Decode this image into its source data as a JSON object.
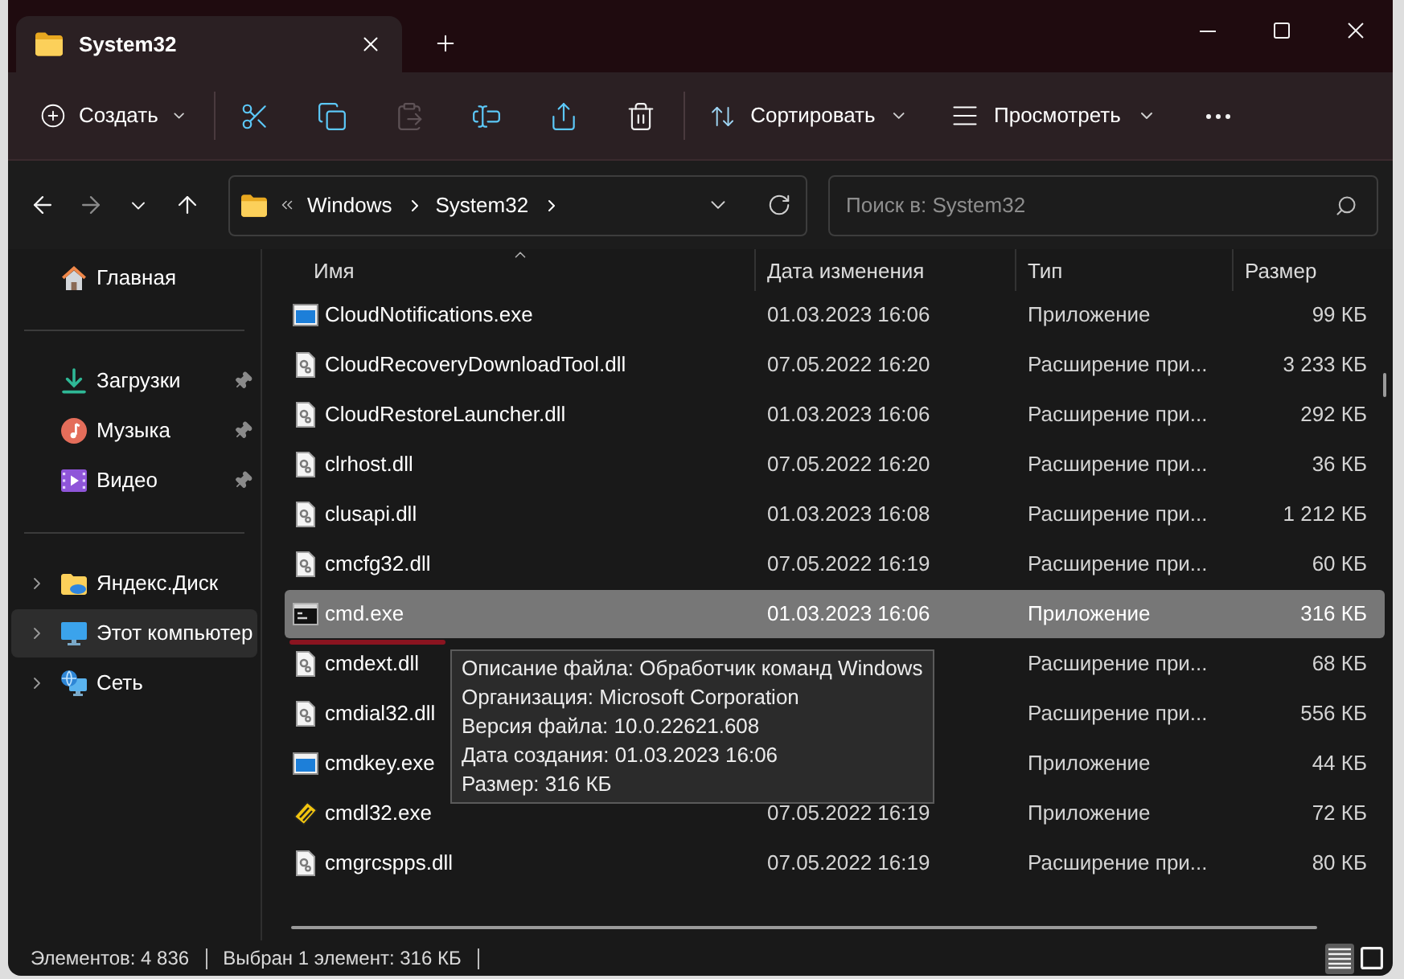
{
  "window": {
    "tab": {
      "title": "System32",
      "selected": true
    }
  },
  "toolbar": {
    "create": "Создать",
    "actions": [
      {
        "kind": "cut",
        "disabled": false
      },
      {
        "kind": "copy",
        "disabled": false
      },
      {
        "kind": "paste",
        "disabled": true
      },
      {
        "kind": "rename",
        "disabled": false
      },
      {
        "kind": "share",
        "disabled": false
      },
      {
        "kind": "delete",
        "disabled": false
      }
    ],
    "sort": "Сортировать",
    "view": "Просмотреть"
  },
  "navigation": [
    {
      "kind": "back",
      "disabled": false
    },
    {
      "kind": "forward",
      "disabled": true
    },
    {
      "kind": "recent",
      "disabled": false
    },
    {
      "kind": "up",
      "disabled": false
    }
  ],
  "address": {
    "crumbs": [
      "Windows",
      "System32"
    ]
  },
  "search": {
    "placeholder": "Поиск в: System32"
  },
  "sidebar": {
    "sections": [
      {
        "items": [
          {
            "label": "Главная",
            "kind": "home",
            "pinned": false,
            "expandable": false,
            "selected": false
          }
        ]
      },
      {
        "items": [
          {
            "label": "Загрузки",
            "kind": "downloads",
            "pinned": true,
            "expandable": false,
            "selected": false
          },
          {
            "label": "Музыка",
            "kind": "music",
            "pinned": true,
            "expandable": false,
            "selected": false
          },
          {
            "label": "Видео",
            "kind": "videos",
            "pinned": true,
            "expandable": false,
            "selected": false
          }
        ]
      },
      {
        "items": [
          {
            "label": "Яндекс.Диск",
            "kind": "cloud-drive",
            "pinned": false,
            "expandable": true,
            "selected": false
          },
          {
            "label": "Этот компьютер",
            "kind": "computer",
            "pinned": false,
            "expandable": true,
            "selected": true
          },
          {
            "label": "Сеть",
            "kind": "network",
            "pinned": false,
            "expandable": true,
            "selected": false
          }
        ]
      }
    ]
  },
  "file_list": {
    "columns": [
      {
        "label": "Имя",
        "sorted": true
      },
      {
        "label": "Дата изменения",
        "sorted": false
      },
      {
        "label": "Тип",
        "sorted": false
      },
      {
        "label": "Размер",
        "sorted": false
      }
    ],
    "rows": [
      {
        "name": "CloudNotifications.exe",
        "date": "01.03.2023 16:06",
        "type": "Приложение",
        "size": "99 КБ",
        "kind": "app",
        "selected": false
      },
      {
        "name": "CloudRecoveryDownloadTool.dll",
        "date": "07.05.2022 16:20",
        "type": "Расширение при...",
        "size": "3 233 КБ",
        "kind": "dll",
        "selected": false
      },
      {
        "name": "CloudRestoreLauncher.dll",
        "date": "01.03.2023 16:06",
        "type": "Расширение при...",
        "size": "292 КБ",
        "kind": "dll",
        "selected": false
      },
      {
        "name": "clrhost.dll",
        "date": "07.05.2022 16:20",
        "type": "Расширение при...",
        "size": "36 КБ",
        "kind": "dll",
        "selected": false
      },
      {
        "name": "clusapi.dll",
        "date": "01.03.2023 16:08",
        "type": "Расширение при...",
        "size": "1 212 КБ",
        "kind": "dll",
        "selected": false
      },
      {
        "name": "cmcfg32.dll",
        "date": "07.05.2022 16:19",
        "type": "Расширение при...",
        "size": "60 КБ",
        "kind": "dll",
        "selected": false
      },
      {
        "name": "cmd.exe",
        "date": "01.03.2023 16:06",
        "type": "Приложение",
        "size": "316 КБ",
        "kind": "console",
        "selected": true
      },
      {
        "name": "cmdext.dll",
        "type": "Расширение при...",
        "size": "68 КБ",
        "kind": "dll",
        "selected": false
      },
      {
        "name": "cmdial32.dll",
        "type": "Расширение при...",
        "size": "556 КБ",
        "kind": "dll",
        "selected": false
      },
      {
        "name": "cmdkey.exe",
        "type": "Приложение",
        "size": "44 КБ",
        "kind": "app",
        "selected": false
      },
      {
        "name": "cmdl32.exe",
        "date": "07.05.2022 16:19",
        "type": "Приложение",
        "size": "72 КБ",
        "kind": "setup",
        "selected": false
      },
      {
        "name": "cmgrcspps.dll",
        "date": "07.05.2022 16:19",
        "type": "Расширение при...",
        "size": "80 КБ",
        "kind": "dll",
        "selected": false
      }
    ]
  },
  "tooltip": {
    "lines": [
      "Описание файла: Обработчик команд Windows",
      "Организация: Microsoft Corporation",
      "Версия файла: 10.0.22621.608",
      "Дата создания: 01.03.2023 16:06",
      "Размер: 316 КБ"
    ]
  },
  "status_bar": {
    "item_count": "Элементов: 4 836",
    "selection": "Выбран 1 элемент: 316 КБ",
    "views": [
      {
        "kind": "details",
        "selected": true
      },
      {
        "kind": "tiles",
        "selected": false
      }
    ]
  }
}
